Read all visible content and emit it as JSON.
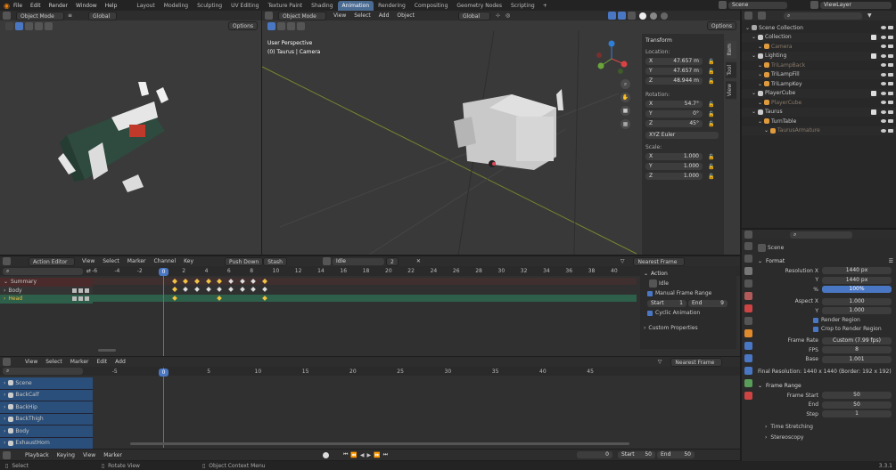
{
  "topbar": {
    "menus": [
      "File",
      "Edit",
      "Render",
      "Window",
      "Help"
    ],
    "workspaces": [
      "Layout",
      "Modeling",
      "Sculpting",
      "UV Editing",
      "Texture Paint",
      "Shading",
      "Animation",
      "Rendering",
      "Compositing",
      "Geometry Nodes",
      "Scripting"
    ],
    "active_workspace": "Animation",
    "add": "+",
    "scene": "Scene",
    "view_layer": "ViewLayer"
  },
  "left_view": {
    "mode": "Object Mode",
    "transform": "Global",
    "options": "Options"
  },
  "main_view": {
    "mode": "Object Mode",
    "menus": [
      "View",
      "Select",
      "Add",
      "Object"
    ],
    "transform": "Global",
    "options": "Options",
    "overlay_title": "User Perspective",
    "overlay_sub": "(0) Taurus | Camera"
  },
  "npanel": {
    "title": "Transform",
    "location": "Location:",
    "loc": [
      [
        "X",
        "47.657 m"
      ],
      [
        "Y",
        "47.657 m"
      ],
      [
        "Z",
        "48.944 m"
      ]
    ],
    "rotation": "Rotation:",
    "rot": [
      [
        "X",
        "54.7°"
      ],
      [
        "Y",
        "0°"
      ],
      [
        "Z",
        "45°"
      ]
    ],
    "euler": "XYZ Euler",
    "scale": "Scale:",
    "scl": [
      [
        "X",
        "1.000"
      ],
      [
        "Y",
        "1.000"
      ],
      [
        "Z",
        "1.000"
      ]
    ],
    "tabs": [
      "Item",
      "Tool",
      "View"
    ]
  },
  "outliner": {
    "items": [
      {
        "t": "Scene Collection",
        "d": 0
      },
      {
        "t": "Collection",
        "d": 1
      },
      {
        "t": "Camera",
        "d": 2,
        "dim": true
      },
      {
        "t": "Lighting",
        "d": 1
      },
      {
        "t": "TriLampBack",
        "d": 2,
        "dim": true
      },
      {
        "t": "TriLampFill",
        "d": 2
      },
      {
        "t": "TriLampKey",
        "d": 2
      },
      {
        "t": "PlayerCube",
        "d": 1
      },
      {
        "t": "PlayerCube",
        "d": 2,
        "dim": true
      },
      {
        "t": "Taurus",
        "d": 1
      },
      {
        "t": "TurnTable",
        "d": 2
      },
      {
        "t": "TaurusArmature",
        "d": 3,
        "dim": true
      }
    ]
  },
  "action_editor": {
    "mode": "Action Editor",
    "menus": [
      "View",
      "Select",
      "Marker",
      "Channel",
      "Key"
    ],
    "push_down": "Push Down",
    "stash": "Stash",
    "action": "Idle",
    "users": "2",
    "snap": "Nearest Frame",
    "ticks": [
      "-6",
      "-4",
      "-2",
      "0",
      "2",
      "4",
      "6",
      "8",
      "10",
      "12",
      "14",
      "16",
      "18",
      "20",
      "22",
      "24",
      "26",
      "28",
      "30",
      "32",
      "34",
      "36",
      "38",
      "40"
    ],
    "current": "0",
    "channels": [
      "Summary",
      "Body",
      "Head"
    ]
  },
  "action_panel": {
    "title": "Action",
    "action": "Idle",
    "manual": "Manual Frame Range",
    "start_label": "Start",
    "start": "1",
    "end_label": "End",
    "end": "9",
    "cyclic": "Cyclic Animation",
    "custom": "Custom Properties"
  },
  "nla": {
    "menus": [
      "View",
      "Select",
      "Marker",
      "Edit",
      "Add"
    ],
    "snap": "Nearest Frame",
    "ticks": [
      "-5",
      "0",
      "5",
      "10",
      "15",
      "20",
      "25",
      "30",
      "35",
      "40",
      "45"
    ],
    "current": "0",
    "tracks": [
      "Scene",
      "BackCalf",
      "BackHip",
      "BackThigh",
      "Body",
      "ExhaustHorn"
    ]
  },
  "properties": {
    "scene": "Scene",
    "format": "Format",
    "res_x_label": "Resolution X",
    "res_x": "1440 px",
    "res_y_label": "Y",
    "res_y": "1440 px",
    "pct_label": "%",
    "pct": "100%",
    "aspect_label": "Aspect X",
    "aspect_x": "1.000",
    "aspect_y_label": "Y",
    "aspect_y": "1.000",
    "render_region": "Render Region",
    "crop": "Crop to Render Region",
    "fr_label": "Frame Rate",
    "fr": "Custom (7.99 fps)",
    "fps_label": "FPS",
    "fps": "8",
    "base_label": "Base",
    "base": "1.001",
    "final": "Final Resolution: 1440 x 1440 (Border: 192 x 192)",
    "frange": "Frame Range",
    "fs_label": "Frame Start",
    "fs": "50",
    "fe_label": "End",
    "fe": "50",
    "step_label": "Step",
    "step": "1",
    "stretch": "Time Stretching",
    "stereo": "Stereoscopy"
  },
  "timeline": {
    "menus": [
      "Playback",
      "Keying",
      "View",
      "Marker"
    ],
    "frame": "0",
    "start_label": "Start",
    "start": "50",
    "end_label": "End",
    "end": "50"
  },
  "status": {
    "select": "Select",
    "rotate": "Rotate View",
    "context": "Object Context Menu",
    "version": "3.3.1"
  }
}
